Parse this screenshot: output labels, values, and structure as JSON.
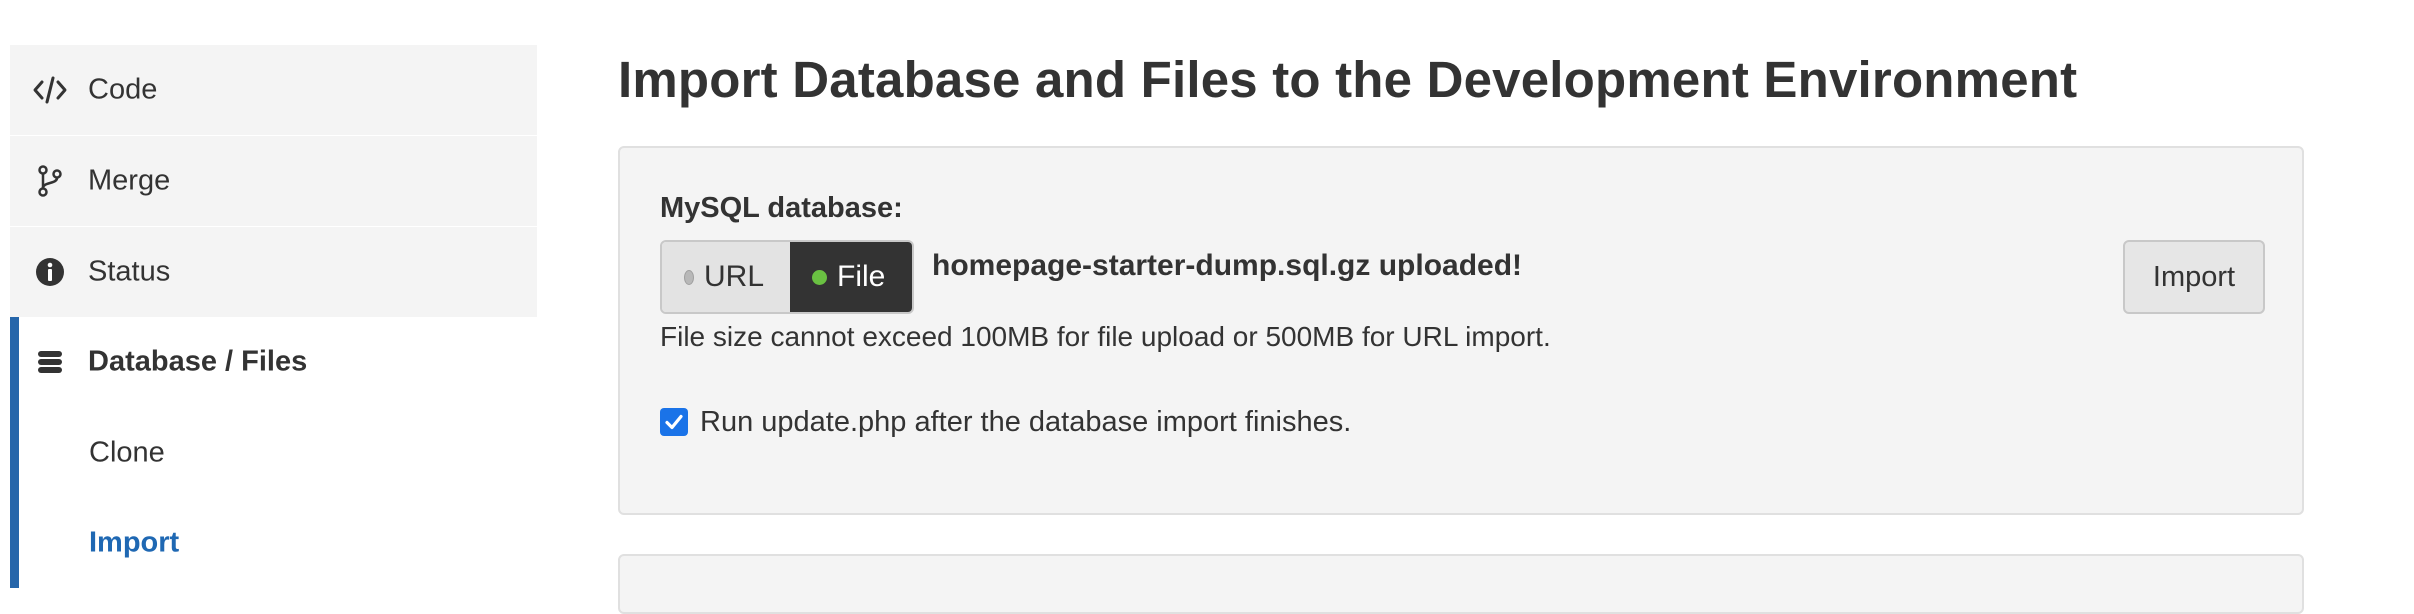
{
  "sidebar": {
    "items": [
      {
        "label": "Code",
        "icon": "code-icon"
      },
      {
        "label": "Merge",
        "icon": "merge-icon"
      },
      {
        "label": "Status",
        "icon": "info-icon"
      },
      {
        "label": "Database / Files",
        "icon": "database-icon"
      },
      {
        "label": "Clone"
      },
      {
        "label": "Import"
      }
    ],
    "active_section": "Database / Files",
    "current_item": "Import"
  },
  "main": {
    "title": "Import Database and Files to the Development Environment",
    "mysql": {
      "label": "MySQL database:",
      "source_options": [
        {
          "label": "URL",
          "selected": false
        },
        {
          "label": "File",
          "selected": true
        }
      ],
      "uploaded_message": "homepage-starter-dump.sql.gz uploaded!",
      "import_button": "Import",
      "help_text": "File size cannot exceed 100MB for file upload or 500MB for URL import.",
      "run_update": {
        "checked": true,
        "label": "Run update.php after the database import finishes."
      }
    }
  },
  "colors": {
    "accent": "#2666aa",
    "link_active": "#1f68b3",
    "panel_bg": "#f4f4f4",
    "selected_toggle_bg": "#333333",
    "selected_dot": "#6ac142",
    "checkbox": "#1a73e8"
  }
}
